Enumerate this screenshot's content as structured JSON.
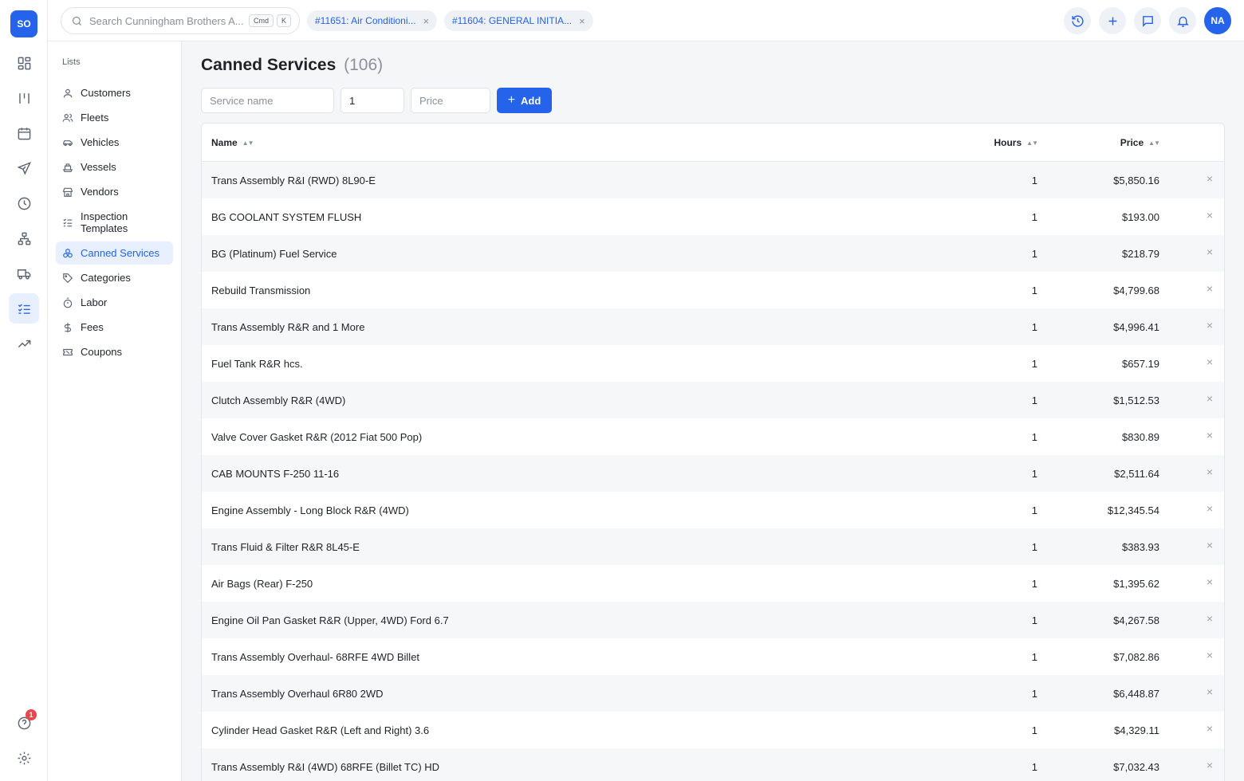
{
  "app": {
    "logo": "SO",
    "user_initials": "NA",
    "help_badge": "1"
  },
  "search": {
    "placeholder": "Search Cunningham Brothers A...",
    "kbd1": "Cmd",
    "kbd2": "K"
  },
  "tabs": [
    {
      "label": "#11651: Air Conditioni..."
    },
    {
      "label": "#11604: GENERAL INITIA..."
    }
  ],
  "subnav": {
    "title": "Lists",
    "items": [
      {
        "label": "Customers",
        "icon": "user-icon"
      },
      {
        "label": "Fleets",
        "icon": "users-icon"
      },
      {
        "label": "Vehicles",
        "icon": "car-icon"
      },
      {
        "label": "Vessels",
        "icon": "ship-icon"
      },
      {
        "label": "Vendors",
        "icon": "store-icon"
      },
      {
        "label": "Inspection Templates",
        "icon": "checklist-icon"
      },
      {
        "label": "Canned Services",
        "icon": "shapes-icon",
        "active": true
      },
      {
        "label": "Categories",
        "icon": "tag-icon"
      },
      {
        "label": "Labor",
        "icon": "timer-icon"
      },
      {
        "label": "Fees",
        "icon": "dollar-icon"
      },
      {
        "label": "Coupons",
        "icon": "ticket-icon"
      }
    ]
  },
  "page": {
    "title": "Canned Services",
    "count": "(106)"
  },
  "form": {
    "name_placeholder": "Service name",
    "hours_value": "1",
    "price_placeholder": "Price",
    "add_label": "Add"
  },
  "table": {
    "headers": {
      "name": "Name",
      "hours": "Hours",
      "price": "Price"
    },
    "rows": [
      {
        "name": "Trans Assembly R&I (RWD) 8L90-E",
        "hours": "1",
        "price": "$5,850.16"
      },
      {
        "name": "BG COOLANT SYSTEM FLUSH",
        "hours": "1",
        "price": "$193.00"
      },
      {
        "name": "BG (Platinum) Fuel Service",
        "hours": "1",
        "price": "$218.79"
      },
      {
        "name": "Rebuild Transmission",
        "hours": "1",
        "price": "$4,799.68"
      },
      {
        "name": "Trans Assembly R&R and 1 More",
        "hours": "1",
        "price": "$4,996.41"
      },
      {
        "name": "Fuel Tank R&R hcs.",
        "hours": "1",
        "price": "$657.19"
      },
      {
        "name": "Clutch Assembly R&R (4WD)",
        "hours": "1",
        "price": "$1,512.53"
      },
      {
        "name": "Valve Cover Gasket R&R (2012 Fiat 500 Pop)",
        "hours": "1",
        "price": "$830.89"
      },
      {
        "name": "CAB MOUNTS F-250 11-16",
        "hours": "1",
        "price": "$2,511.64"
      },
      {
        "name": "Engine Assembly - Long Block R&R (4WD)",
        "hours": "1",
        "price": "$12,345.54"
      },
      {
        "name": "Trans Fluid & Filter R&R 8L45-E",
        "hours": "1",
        "price": "$383.93"
      },
      {
        "name": "Air Bags (Rear) F-250",
        "hours": "1",
        "price": "$1,395.62"
      },
      {
        "name": "Engine Oil Pan Gasket R&R (Upper, 4WD) Ford 6.7",
        "hours": "1",
        "price": "$4,267.58"
      },
      {
        "name": "Trans Assembly Overhaul- 68RFE 4WD Billet",
        "hours": "1",
        "price": "$7,082.86"
      },
      {
        "name": "Trans Assembly Overhaul 6R80 2WD",
        "hours": "1",
        "price": "$6,448.87"
      },
      {
        "name": "Cylinder Head Gasket R&R (Left and Right) 3.6",
        "hours": "1",
        "price": "$4,329.11"
      },
      {
        "name": "Trans Assembly R&I (4WD) 68RFE (Billet TC) HD",
        "hours": "1",
        "price": "$7,032.43"
      }
    ]
  },
  "colors": {
    "accent": "#2563eb",
    "active_bg": "#e8efff",
    "badge": "#e5484d"
  }
}
